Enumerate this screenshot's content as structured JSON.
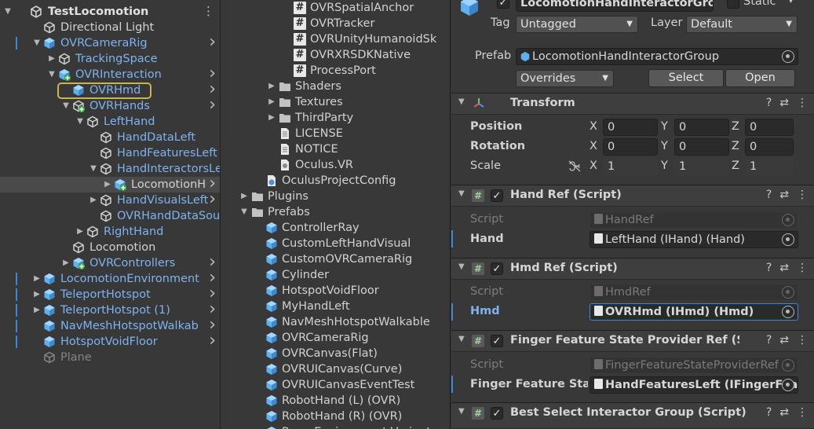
{
  "hierarchy": {
    "scene_name": "TestLocomotion",
    "items": [
      {
        "label": "Directional Light",
        "color": "normal"
      },
      {
        "label": "OVRCameraRig",
        "color": "blue"
      },
      {
        "label": "TrackingSpace",
        "color": "blue"
      },
      {
        "label": "OVRInteraction",
        "color": "blue"
      },
      {
        "label": "OVRHmd",
        "color": "blue"
      },
      {
        "label": "OVRHands",
        "color": "blue"
      },
      {
        "label": "LeftHand",
        "color": "blue"
      },
      {
        "label": "HandDataLeft",
        "color": "blue"
      },
      {
        "label": "HandFeaturesLeft",
        "color": "blue"
      },
      {
        "label": "HandInteractorsLe",
        "color": "blue"
      },
      {
        "label": "LocomotionH",
        "color": "normal"
      },
      {
        "label": "HandVisualsLeft",
        "color": "blue"
      },
      {
        "label": "OVRHandDataSou",
        "color": "blue"
      },
      {
        "label": "RightHand",
        "color": "blue"
      },
      {
        "label": "Locomotion",
        "color": "normal"
      },
      {
        "label": "OVRControllers",
        "color": "blue"
      },
      {
        "label": "LocomotionEnvironment",
        "color": "blue"
      },
      {
        "label": "TeleportHotspot",
        "color": "blue"
      },
      {
        "label": "TeleportHotspot (1)",
        "color": "blue"
      },
      {
        "label": "NavMeshHotspotWalkab",
        "color": "blue"
      },
      {
        "label": "HotspotVoidFloor",
        "color": "blue"
      },
      {
        "label": "Plane",
        "color": "dim"
      }
    ]
  },
  "project": {
    "items": [
      {
        "label": "OVRSpatialAnchor"
      },
      {
        "label": "OVRTracker"
      },
      {
        "label": "OVRUnityHumanoidSk"
      },
      {
        "label": "OVRXRSDKNative"
      },
      {
        "label": "ProcessPort"
      },
      {
        "label": "Shaders"
      },
      {
        "label": "Textures"
      },
      {
        "label": "ThirdParty"
      },
      {
        "label": "LICENSE"
      },
      {
        "label": "NOTICE"
      },
      {
        "label": "Oculus.VR"
      },
      {
        "label": "OculusProjectConfig"
      },
      {
        "label": "Plugins"
      },
      {
        "label": "Prefabs"
      },
      {
        "label": "ControllerRay"
      },
      {
        "label": "CustomLeftHandVisual"
      },
      {
        "label": "CustomOVRCameraRig"
      },
      {
        "label": "Cylinder"
      },
      {
        "label": "HotspotVoidFloor"
      },
      {
        "label": "MyHandLeft"
      },
      {
        "label": "NavMeshHotspotWalkable"
      },
      {
        "label": "OVRCameraRig"
      },
      {
        "label": "OVRCanvas(Flat)"
      },
      {
        "label": "OVRUICanvas(Curve)"
      },
      {
        "label": "OVRUICanvasEventTest"
      },
      {
        "label": "RobotHand (L) (OVR)"
      },
      {
        "label": "RobotHand (R) (OVR)"
      },
      {
        "label": "RoomEnvironment Variant"
      }
    ]
  },
  "inspector": {
    "object_name": "LocomotionHandInteractorGroup",
    "static_label": "Static",
    "tag_label": "Tag",
    "tag_value": "Untagged",
    "layer_label": "Layer",
    "layer_value": "Default",
    "prefab_label": "Prefab",
    "prefab_value": "LocomotionHandInteractorGroup",
    "overrides_label": "Overrides",
    "select_label": "Select",
    "open_label": "Open",
    "transform": {
      "title": "Transform",
      "position_label": "Position",
      "rotation_label": "Rotation",
      "scale_label": "Scale",
      "x": "X",
      "y": "Y",
      "z": "Z",
      "position": [
        "0",
        "0",
        "0"
      ],
      "rotation": [
        "0",
        "0",
        "0"
      ],
      "scale": [
        "1",
        "1",
        "1"
      ]
    },
    "hand_ref": {
      "title": "Hand Ref (Script)",
      "script_label": "Script",
      "script_value": "HandRef",
      "field_label": "Hand",
      "field_value": "LeftHand (IHand) (Hand)"
    },
    "hmd_ref": {
      "title": "Hmd Ref (Script)",
      "script_label": "Script",
      "script_value": "HmdRef",
      "field_label": "Hmd",
      "field_value": "OVRHmd (IHmd) (Hmd)"
    },
    "finger_ref": {
      "title": "Finger Feature State Provider Ref (Script)",
      "script_label": "Script",
      "script_value": "FingerFeatureStateProviderRef",
      "field_label": "Finger Feature State",
      "field_value": "HandFeaturesLeft (IFingerFeatureStateProvider)"
    },
    "best_select": {
      "title": "Best Select Interactor Group (Script)"
    }
  }
}
